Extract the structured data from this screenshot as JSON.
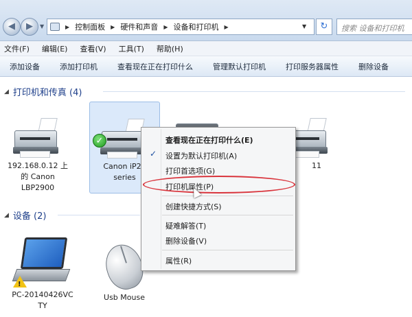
{
  "address_bar": {
    "crumbs": [
      "控制面板",
      "硬件和声音",
      "设备和打印机"
    ],
    "search_placeholder": "搜索 设备和打印机"
  },
  "menu": [
    "文件(F)",
    "编辑(E)",
    "查看(V)",
    "工具(T)",
    "帮助(H)"
  ],
  "commands": [
    "添加设备",
    "添加打印机",
    "查看现在正在打印什么",
    "管理默认打印机",
    "打印服务器属性",
    "删除设备"
  ],
  "groups": {
    "printers": {
      "title": "打印机和传真 (4)",
      "items": [
        {
          "line1": "192.168.0.12 上",
          "line2": "的 Canon",
          "line3": "LBP2900"
        },
        {
          "line1": "Canon iP27",
          "line2": "series"
        },
        {
          "line1": ""
        },
        {
          "line1": "11"
        }
      ]
    },
    "devices": {
      "title": "设备 (2)",
      "items": [
        {
          "line1": "PC-20140426VC",
          "line2": "TY"
        },
        {
          "line1": "Usb Mouse"
        }
      ]
    }
  },
  "context_menu": {
    "items": [
      {
        "label": "查看现在正在打印什么(E)",
        "bold": true
      },
      {
        "label": "设置为默认打印机(A)",
        "checked": true
      },
      {
        "label": "打印首选项(G)"
      },
      {
        "label": "打印机属性(P)"
      },
      {
        "label": "创建快捷方式(S)"
      },
      {
        "label": "疑难解答(T)"
      },
      {
        "label": "删除设备(V)"
      },
      {
        "label": "属性(R)"
      }
    ]
  }
}
